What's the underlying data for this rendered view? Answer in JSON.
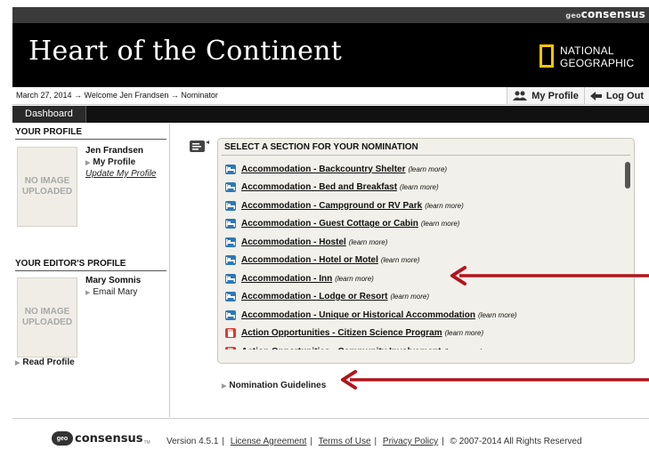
{
  "brand": {
    "prefix": "geo",
    "name": "consensus"
  },
  "header": {
    "title": "Heart of the Continent",
    "partner_line1": "NATIONAL",
    "partner_line2": "GEOGRAPHIC",
    "partner_accent": "#f7c600"
  },
  "subbar": {
    "breadcrumb": "March 27, 2014 → Welcome Jen Frandsen → Nominator",
    "my_profile": "My Profile",
    "log_out": "Log Out"
  },
  "tabs": [
    {
      "label": "Dashboard"
    }
  ],
  "sidebar": {
    "your_profile": {
      "title": "YOUR PROFILE",
      "image_placeholder": "NO IMAGE UPLOADED",
      "name": "Jen Frandsen",
      "link1": "My Profile",
      "link2": "Update My Profile"
    },
    "editor_profile": {
      "title": "YOUR EDITOR'S PROFILE",
      "image_placeholder": "NO IMAGE UPLOADED",
      "name": "Mary Somnis",
      "link1": "Email Mary",
      "read_profile": "Read Profile"
    }
  },
  "panel": {
    "title": "SELECT A SECTION FOR YOUR NOMINATION",
    "learn_more": "(learn more)",
    "items": [
      {
        "label": "Accommodation - Backcountry Shelter",
        "icon": "bed-icon"
      },
      {
        "label": "Accommodation - Bed and Breakfast",
        "icon": "bed-icon"
      },
      {
        "label": "Accommodation - Campground or RV Park",
        "icon": "bed-icon"
      },
      {
        "label": "Accommodation - Guest Cottage or Cabin",
        "icon": "bed-icon"
      },
      {
        "label": "Accommodation - Hostel",
        "icon": "bed-icon"
      },
      {
        "label": "Accommodation - Hotel or Motel",
        "icon": "bed-icon"
      },
      {
        "label": "Accommodation - Inn",
        "icon": "bed-icon"
      },
      {
        "label": "Accommodation - Lodge or Resort",
        "icon": "bed-icon"
      },
      {
        "label": "Accommodation - Unique or Historical Accommodation",
        "icon": "bed-icon"
      },
      {
        "label": "Action Opportunities - Citizen Science Program",
        "icon": "hand-icon"
      },
      {
        "label": "Action Opportunities - Community Involvement",
        "icon": "hand-icon"
      }
    ]
  },
  "guidelines": {
    "label": "Nomination Guidelines"
  },
  "footer": {
    "logo_prefix": "geo",
    "logo_name": "consensus",
    "tm": "TM",
    "version": "Version 4.5.1",
    "license": "License Agreement",
    "terms": "Terms of Use",
    "privacy": "Privacy Policy",
    "copyright": "© 2007-2014 All Rights Reserved"
  },
  "annotation_color": "#b3141c"
}
